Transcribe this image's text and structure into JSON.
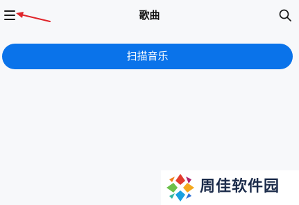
{
  "header": {
    "title": "歌曲",
    "menu_icon": "hamburger-menu-icon",
    "search_icon": "search-icon"
  },
  "main": {
    "scan_button_label": "扫描音乐"
  },
  "watermark": {
    "text": "周佳软件园"
  },
  "colors": {
    "accent": "#0a73ea",
    "background": "#f7f8fa",
    "annotation_arrow": "#e0242a"
  }
}
